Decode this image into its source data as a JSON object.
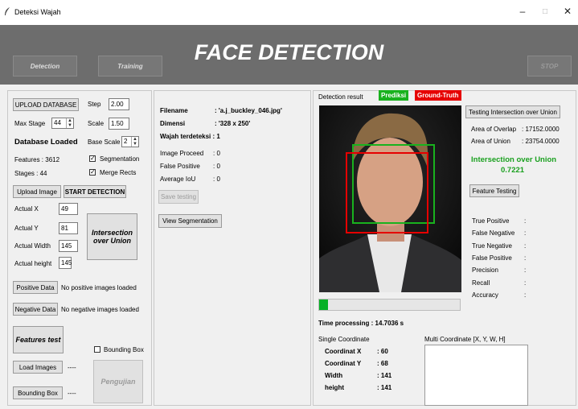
{
  "window": {
    "title": "Deteksi Wajah",
    "minimize": "–",
    "maximize": "□",
    "close": "✕"
  },
  "header": {
    "title": "FACE DETECTION",
    "detection_btn": "Detection",
    "training_btn": "Training",
    "stop_btn": "STOP"
  },
  "left": {
    "upload_db": "UPLOAD DATABASE",
    "step_label": "Step",
    "step_value": "2.00",
    "max_stage_label": "Max Stage",
    "max_stage_value": "44",
    "scale_label": "Scale",
    "scale_value": "1.50",
    "db_loaded": "Database Loaded",
    "base_scale_label": "Base Scale",
    "base_scale_value": "2",
    "features": "Features : 3612",
    "stages": "Stages  : 44",
    "segmentation": "Segmentation",
    "merge_rects": "Merge Rects",
    "upload_image": "Upload Image",
    "start_detection": "START DETECTION",
    "actual_x_label": "Actual X",
    "actual_x": "49",
    "actual_y_label": "Actual Y",
    "actual_y": "81",
    "actual_w_label": "Actual Width",
    "actual_w": "145",
    "actual_h_label": "Actual height",
    "actual_h": "145",
    "iou_btn": "Intersection over Union",
    "positive_btn": "Positive Data",
    "positive_status": "No positive images loaded",
    "negative_btn": "Negative Data",
    "negative_status": "No negative images loaded",
    "features_test": "Features test",
    "bounding_box_cb": "Bounding Box",
    "load_images": "Load Images",
    "load_images_status": "----",
    "bounding_box_btn": "Bounding Box",
    "bounding_box_status": "----",
    "pengujian": "Pengujian"
  },
  "middle": {
    "filename_label": "Filename",
    "filename_value": ": 'a.j_buckley_046.jpg'",
    "dimensi_label": "Dimensi",
    "dimensi_value": ": '328 x 250'",
    "wajah_label": "Wajah terdeteksi : 1",
    "image_proceed_label": "Image Proceed",
    "image_proceed_value": ": 0",
    "false_positive_label": "False Positive",
    "false_positive_value": ": 0",
    "avg_iou_label": "Average IoU",
    "avg_iou_value": ": 0",
    "save_testing": "Save testing",
    "view_segmentation": "View Segmentation"
  },
  "right": {
    "detection_result": "Detection result",
    "prediksi": "Prediksi",
    "ground_truth": "Ground-Truth",
    "testing_iou_btn": "Testing Intersection over Union",
    "area_overlap_label": "Area of Overlap",
    "area_overlap_value": ": 17152.0000",
    "area_union_label": "Area of Union",
    "area_union_value": ": 23754.0000",
    "iou_title": "Intersection over Union",
    "iou_value": "0.7221",
    "feature_testing": "Feature Testing",
    "metrics": [
      {
        "label": "True Positive",
        "value": ":"
      },
      {
        "label": "False Negative",
        "value": ":"
      },
      {
        "label": "True Negative",
        "value": ":"
      },
      {
        "label": "False Positive",
        "value": ":"
      },
      {
        "label": "Precision",
        "value": ":"
      },
      {
        "label": "Recall",
        "value": ":"
      },
      {
        "label": "Accuracy",
        "value": ":"
      }
    ],
    "progress_fraction": 0.06,
    "time_processing": "Time processing : 14.7036 s",
    "single_coord": "Single Coordinate",
    "multi_coord": "Multi Coordinate [X, Y, W, H]",
    "coord_x_label": "Coordinat X",
    "coord_x_value": ": 60",
    "coord_y_label": "Coordinat Y",
    "coord_y_value": ": 68",
    "width_label": "Width",
    "width_value": ": 141",
    "height_label": "height",
    "height_value": ": 141"
  },
  "colors": {
    "prediksi": "#19b21e",
    "ground_truth": "#e60000",
    "iou_text": "#1aa01f",
    "header_bg": "#6d6d6d"
  }
}
